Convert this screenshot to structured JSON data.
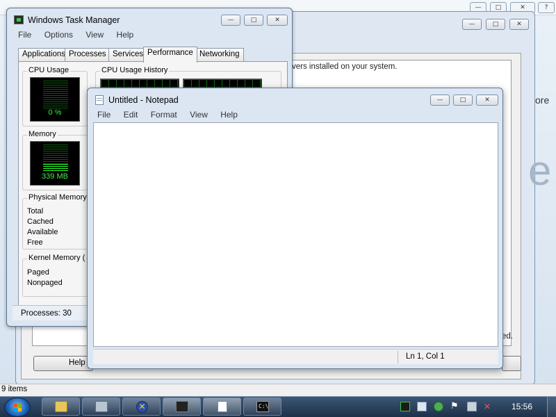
{
  "background_window": {
    "text_line": "vers installed on your system.",
    "trailing_text": "ed.",
    "help_button": "Help",
    "right_edge_text": "ore",
    "right_edge_big": "e",
    "items_count": "9 items"
  },
  "task_manager": {
    "title": "Windows Task Manager",
    "menu": [
      "File",
      "Options",
      "View",
      "Help"
    ],
    "tabs": [
      "Applications",
      "Processes",
      "Services",
      "Performance",
      "Networking"
    ],
    "active_tab": "Performance",
    "cpu_usage": {
      "label": "CPU Usage",
      "value": "0 %",
      "level": 0
    },
    "cpu_history": {
      "label": "CPU Usage History"
    },
    "memory": {
      "label": "Memory",
      "value": "339 MB",
      "level": 0.3
    },
    "physical_memory": {
      "label": "Physical Memory",
      "rows": [
        "Total",
        "Cached",
        "Available",
        "Free"
      ]
    },
    "kernel_memory": {
      "label": "Kernel Memory (",
      "rows": [
        "Paged",
        "Nonpaged"
      ]
    },
    "status": "Processes: 30"
  },
  "notepad": {
    "title": "Untitled - Notepad",
    "menu": [
      "File",
      "Edit",
      "Format",
      "View",
      "Help"
    ],
    "content": "",
    "cursor_position": "Ln 1, Col 1"
  },
  "taskbar": {
    "clock": "15:56",
    "buttons": [
      "explorer",
      "device-manager",
      "directx",
      "task-manager",
      "notepad",
      "command-prompt"
    ]
  },
  "colors": {
    "meter_green": "#3df23d",
    "titlebar": "#dbe6f2",
    "taskbar": "#1d3048"
  }
}
